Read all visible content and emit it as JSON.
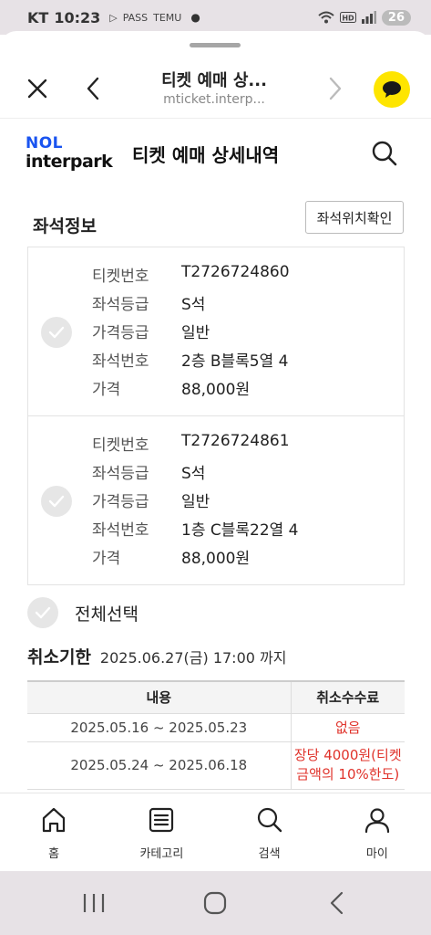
{
  "status_bar": {
    "carrier": "KT",
    "time": "10:23",
    "notif_icons": [
      "play-icon",
      "PASS",
      "TEMU"
    ],
    "battery": "26"
  },
  "browser": {
    "title": "티켓 예매 상...",
    "url": "mticket.interp..."
  },
  "header": {
    "logo_top": "NOL",
    "logo_bottom": "interpark",
    "title": "티켓 예매 상세내역"
  },
  "seat_section": {
    "title": "좌석정보",
    "seat_map_button": "좌석위치확인",
    "tickets": [
      {
        "rows": [
          {
            "label": "티켓번호",
            "value": "T2726724860"
          },
          {
            "label": "좌석등급",
            "value": "S석"
          },
          {
            "label": "가격등급",
            "value": "일반"
          },
          {
            "label": "좌석번호",
            "value": "2층 B블록5열 4"
          },
          {
            "label": "가격",
            "value": "88,000원"
          }
        ]
      },
      {
        "rows": [
          {
            "label": "티켓번호",
            "value": "T2726724861"
          },
          {
            "label": "좌석등급",
            "value": "S석"
          },
          {
            "label": "가격등급",
            "value": "일반"
          },
          {
            "label": "좌석번호",
            "value": "1층 C블록22열 4"
          },
          {
            "label": "가격",
            "value": "88,000원"
          }
        ]
      }
    ],
    "select_all": "전체선택"
  },
  "cancel": {
    "title": "취소기한",
    "deadline": "2025.06.27(금) 17:00 까지",
    "table": {
      "headers": [
        "내용",
        "취소수수료"
      ],
      "rows": [
        {
          "period": "2025.05.16 ~ 2025.05.23",
          "fee_line1": "없음",
          "fee_line2": ""
        },
        {
          "period": "2025.05.24 ~ 2025.06.18",
          "fee_line1": "장당 4000원(티켓",
          "fee_line2": "금액의 10%한도)"
        }
      ]
    }
  },
  "bottom_nav": [
    {
      "label": "홈",
      "icon": "home-icon"
    },
    {
      "label": "카테고리",
      "icon": "category-icon"
    },
    {
      "label": "검색",
      "icon": "search-icon"
    },
    {
      "label": "마이",
      "icon": "person-icon"
    }
  ],
  "colors": {
    "brand_blue": "#1a54f0",
    "kakao_yellow": "#fee500",
    "fee_red": "#e0332b",
    "system_bar": "#e7e2e6"
  }
}
